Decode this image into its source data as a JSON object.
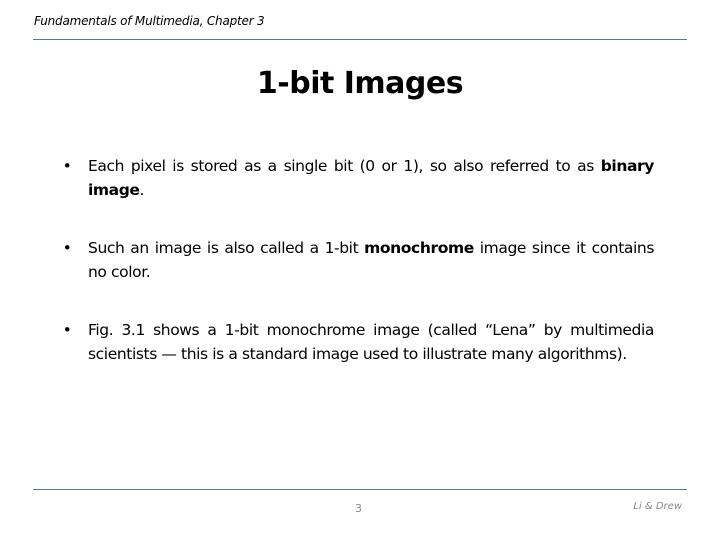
{
  "header": {
    "text": "Fundamentals of Multimedia, Chapter 3"
  },
  "slide": {
    "title": "1-bit Images",
    "bullets": [
      {
        "parts": [
          {
            "text": "Each pixel is stored as a single bit (0 or 1), so also referred to as ",
            "bold": false
          },
          {
            "text": "binary image",
            "bold": true
          },
          {
            "text": ".",
            "bold": false
          }
        ]
      },
      {
        "parts": [
          {
            "text": "Such an image is also called a 1-bit ",
            "bold": false
          },
          {
            "text": "monochrome",
            "bold": true
          },
          {
            "text": " image since it contains no color.",
            "bold": false
          }
        ]
      },
      {
        "parts": [
          {
            "text": "Fig. 3.1 shows a 1-bit monochrome image (called “Lena” by multimedia scientists — this is a standard image used to illustrate many algorithms).",
            "bold": false
          }
        ]
      }
    ],
    "bullet_glyph": "•"
  },
  "footer": {
    "page_number": "3",
    "authors": "Li & Drew"
  },
  "colors": {
    "rule": "#5f7a86",
    "footer_text": "#8a8a8a"
  }
}
